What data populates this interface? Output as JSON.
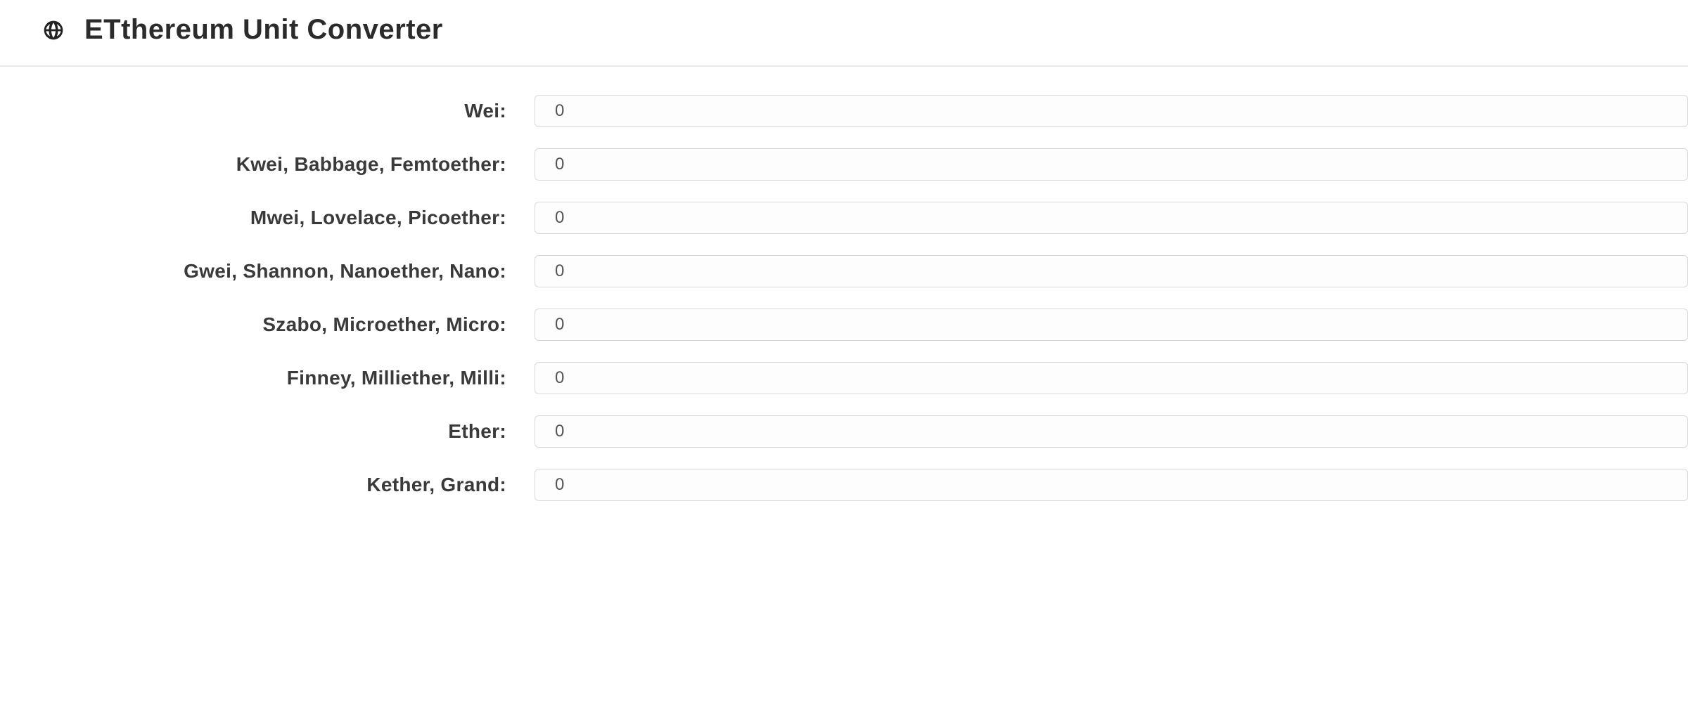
{
  "header": {
    "title": "ETthereum Unit Converter"
  },
  "icons": {
    "globe": "globe-icon"
  },
  "units": [
    {
      "label": "Wei:",
      "value": "0"
    },
    {
      "label": "Kwei, Babbage, Femtoether:",
      "value": "0"
    },
    {
      "label": "Mwei, Lovelace, Picoether:",
      "value": "0"
    },
    {
      "label": "Gwei, Shannon, Nanoether, Nano:",
      "value": "0"
    },
    {
      "label": "Szabo, Microether, Micro:",
      "value": "0"
    },
    {
      "label": "Finney, Milliether, Milli:",
      "value": "0"
    },
    {
      "label": "Ether:",
      "value": "0"
    },
    {
      "label": "Kether, Grand:",
      "value": "0"
    }
  ]
}
